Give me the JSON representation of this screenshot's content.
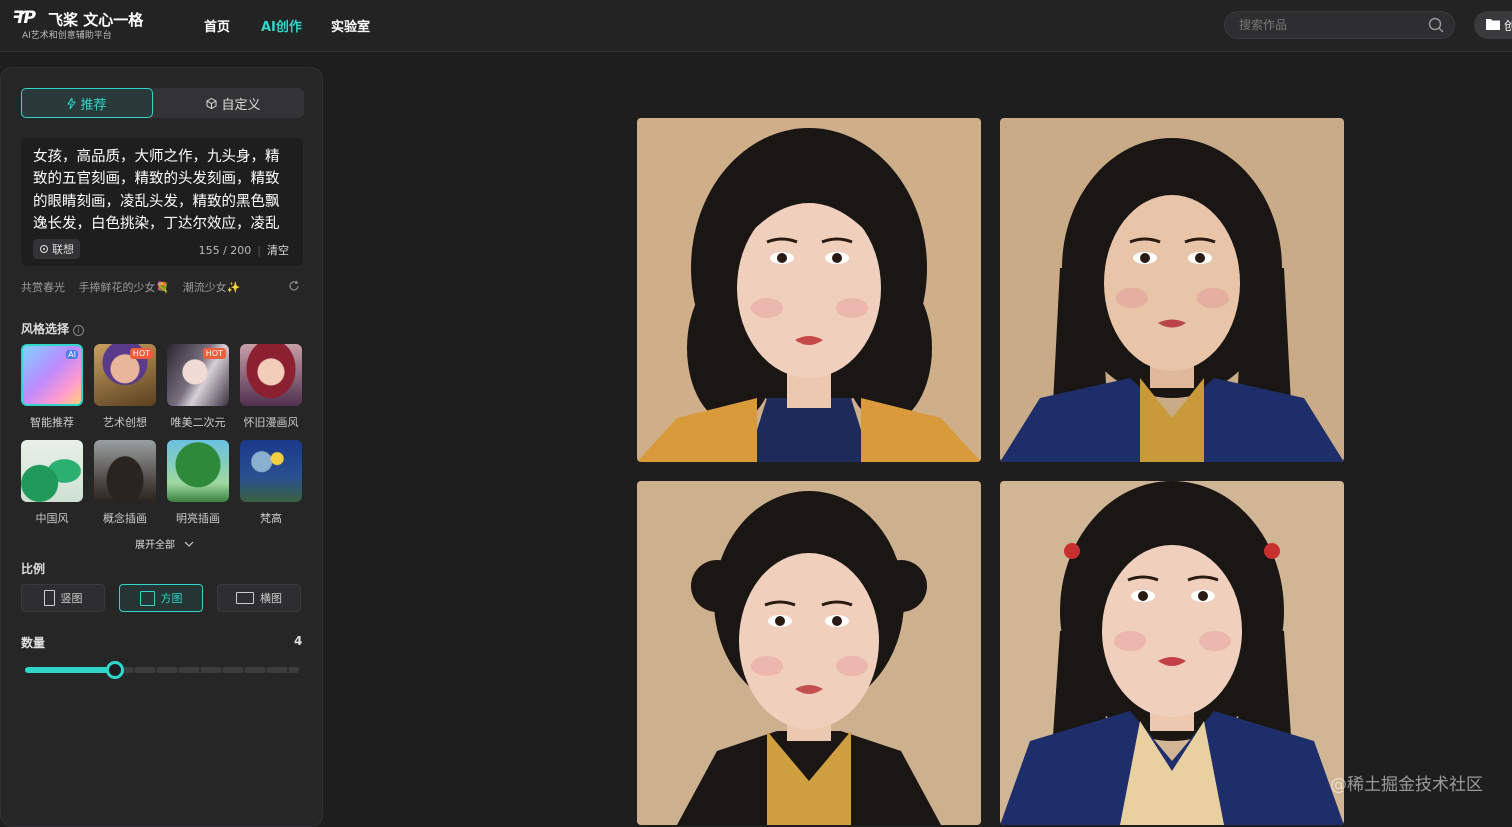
{
  "header": {
    "logo_mark": "ꟻƤ",
    "logo_title": "飞桨 文心一格",
    "logo_subtitle": "AI艺术和创意辅助平台",
    "nav": [
      {
        "label": "首页",
        "active": false
      },
      {
        "label": "AI创作",
        "active": true
      },
      {
        "label": "实验室",
        "active": false
      }
    ],
    "search": {
      "placeholder": "搜索作品",
      "value": ""
    },
    "folder_label": "创"
  },
  "panel": {
    "mode_tabs": [
      {
        "label": "推荐",
        "icon": "lightning-icon",
        "active": true
      },
      {
        "label": "自定义",
        "icon": "cube-icon",
        "active": false
      }
    ],
    "prompt": {
      "text": "女孩，高品质，大师之作，九头身，精致的五官刻画，精致的头发刻画，精致的眼睛刻画，凌乱头发，精致的黑色飘逸长发，白色挑染，丁达尔效应，凌乱",
      "assoc_label": "联想",
      "count": "155",
      "max": "200",
      "clear_label": "清空"
    },
    "suggestions": [
      "共赏春光",
      "手捧鲜花的少女💐",
      "潮流少女✨"
    ],
    "style_section": {
      "title": "风格选择",
      "items": [
        {
          "label": "智能推荐",
          "badge": "AI"
        },
        {
          "label": "艺术创想",
          "badge": "HOT"
        },
        {
          "label": "唯美二次元",
          "badge": "HOT"
        },
        {
          "label": "怀旧漫画风",
          "badge": ""
        },
        {
          "label": "中国风",
          "badge": ""
        },
        {
          "label": "概念插画",
          "badge": ""
        },
        {
          "label": "明亮插画",
          "badge": ""
        },
        {
          "label": "梵高",
          "badge": ""
        }
      ],
      "expand_label": "展开全部"
    },
    "ratio": {
      "title": "比例",
      "options": [
        {
          "label": "竖图",
          "active": false
        },
        {
          "label": "方图",
          "active": true
        },
        {
          "label": "横图",
          "active": false
        }
      ]
    },
    "quantity": {
      "title": "数量",
      "value": "4",
      "min": 1,
      "max": 9,
      "current": 4
    }
  },
  "results": {
    "count": 4,
    "images": [
      "portrait-1",
      "portrait-2",
      "portrait-3",
      "portrait-4"
    ]
  },
  "watermark": "@稀土掘金技术社区",
  "colors": {
    "accent": "#2fd6c9",
    "background": "#1e1e1f",
    "panel": "#262627"
  }
}
